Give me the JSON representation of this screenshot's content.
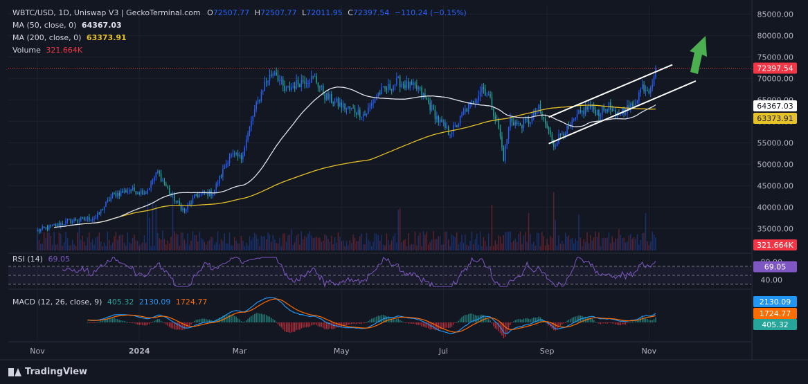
{
  "header": {
    "symbol": "WBTC/USD, 1D, Uniswap V3 | GeckoTerminal.com",
    "o_label": "O",
    "o_value": "72507.77",
    "h_label": "H",
    "h_value": "72507.77",
    "l_label": "L",
    "l_value": "72011.95",
    "c_label": "C",
    "c_value": "72397.54",
    "change": "−110.24 (−0.15%)",
    "ma50_label": "MA (50, close, 0)",
    "ma50_value": "64367.03",
    "ma200_label": "MA (200, close, 0)",
    "ma200_value": "63373.91",
    "volume_label": "Volume",
    "volume_value": "321.664K"
  },
  "rsi_legend": {
    "label": "RSI (14)",
    "value": "69.05"
  },
  "macd_legend": {
    "label": "MACD (12, 26, close, 9)",
    "v1": "405.32",
    "v2": "2130.09",
    "v3": "1724.77"
  },
  "footer": {
    "brand": "TradingView"
  },
  "colors": {
    "background": "#131722",
    "up": "#2962ff",
    "down": "#26a69a",
    "ma50": "#e0e3eb",
    "ma200": "#e6c228",
    "price_line": "#f23645",
    "rsi": "#7e57c2",
    "macd": "#2196f3",
    "signal": "#ff6d00",
    "arrow": "#4caf50"
  },
  "chart_data": {
    "type": "candlestick",
    "price_axis": {
      "ticks": [
        "85000.00",
        "80000.00",
        "75000.00",
        "70000.00",
        "65000.00",
        "60000.00",
        "55000.00",
        "50000.00",
        "45000.00",
        "40000.00",
        "35000.00"
      ],
      "ylim": [
        31500,
        87000
      ]
    },
    "rsi_axis": {
      "ticks": [
        "80.00",
        "40.00"
      ],
      "ylim": [
        25,
        90
      ],
      "bands": [
        70,
        30
      ]
    },
    "x_axis": {
      "labels": [
        "Nov",
        "2024",
        "Mar",
        "May",
        "Jul",
        "Sep",
        "Nov"
      ],
      "label_days": [
        0,
        61,
        121,
        182,
        243,
        305,
        366
      ]
    },
    "last_price_label": "72397.54",
    "ma50_label": "64367.03",
    "ma200_label": "63373.91",
    "volume_label": "321.664K",
    "rsi_label": "69.05",
    "macd_labels": {
      "macd": "2130.09",
      "signal": "1724.77",
      "hist": "405.32"
    },
    "price_anchors": [
      [
        0,
        34500
      ],
      [
        20,
        36800
      ],
      [
        35,
        37500
      ],
      [
        45,
        42800
      ],
      [
        55,
        44000
      ],
      [
        65,
        43500
      ],
      [
        72,
        48200
      ],
      [
        80,
        42800
      ],
      [
        88,
        39000
      ],
      [
        95,
        42800
      ],
      [
        105,
        43300
      ],
      [
        110,
        47500
      ],
      [
        115,
        52000
      ],
      [
        122,
        51500
      ],
      [
        130,
        62500
      ],
      [
        136,
        68800
      ],
      [
        142,
        72000
      ],
      [
        148,
        67000
      ],
      [
        154,
        68500
      ],
      [
        160,
        69800
      ],
      [
        166,
        70000
      ],
      [
        172,
        66000
      ],
      [
        178,
        64500
      ],
      [
        184,
        63200
      ],
      [
        190,
        62500
      ],
      [
        196,
        61500
      ],
      [
        204,
        66500
      ],
      [
        210,
        67800
      ],
      [
        216,
        69300
      ],
      [
        222,
        68200
      ],
      [
        228,
        67500
      ],
      [
        234,
        64200
      ],
      [
        240,
        60200
      ],
      [
        246,
        57500
      ],
      [
        250,
        58500
      ],
      [
        256,
        62500
      ],
      [
        262,
        65000
      ],
      [
        266,
        68000
      ],
      [
        270,
        66000
      ],
      [
        276,
        58500
      ],
      [
        279,
        51500
      ],
      [
        283,
        60500
      ],
      [
        288,
        59000
      ],
      [
        294,
        60000
      ],
      [
        300,
        62800
      ],
      [
        305,
        58500
      ],
      [
        309,
        54500
      ],
      [
        314,
        57500
      ],
      [
        318,
        58200
      ],
      [
        324,
        61500
      ],
      [
        330,
        63500
      ],
      [
        336,
        62000
      ],
      [
        342,
        63500
      ],
      [
        346,
        61000
      ],
      [
        350,
        62500
      ],
      [
        356,
        63500
      ],
      [
        360,
        66500
      ],
      [
        362,
        68200
      ],
      [
        366,
        67500
      ],
      [
        368,
        69500
      ],
      [
        370,
        72397
      ]
    ],
    "annotations": {
      "channel_upper": [
        [
          306,
          61000
        ],
        [
          380,
          73200
        ]
      ],
      "channel_lower": [
        [
          306,
          54800
        ],
        [
          394,
          69400
        ]
      ],
      "arrow": "up-right"
    }
  }
}
